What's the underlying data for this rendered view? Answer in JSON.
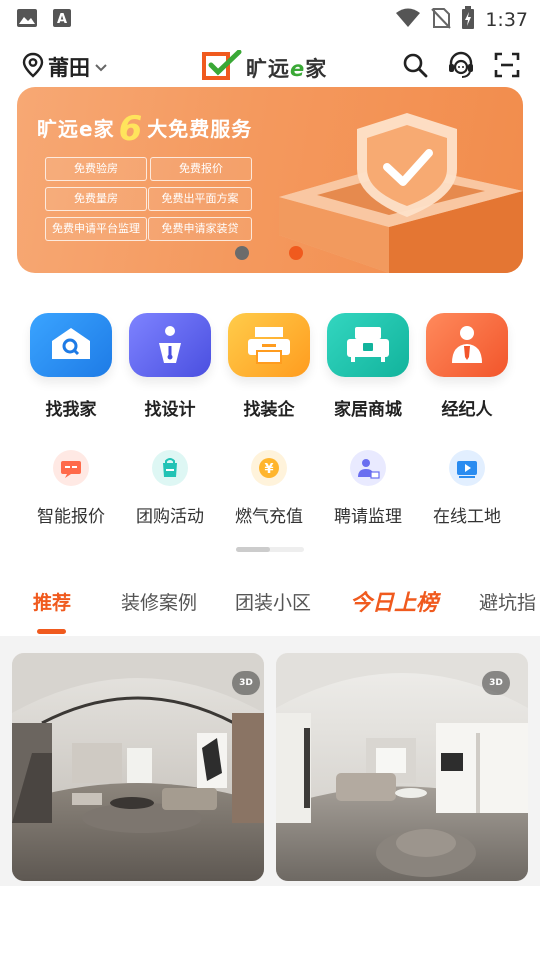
{
  "status_bar": {
    "time": "1:37",
    "icons": [
      "image-icon",
      "a-icon",
      "wifi-icon",
      "no-sim-icon",
      "battery-charging-icon"
    ]
  },
  "header": {
    "location": "莆田",
    "logo_text_a": "旷远",
    "logo_text_e": "e",
    "logo_text_b": "家",
    "icons": [
      "search-icon",
      "customer-service-icon",
      "scan-icon"
    ]
  },
  "banner": {
    "title_a": "旷远e家",
    "title_num": "6",
    "title_b": "大免费服务",
    "chips": [
      "免费验房",
      "免费报价",
      "免费量房",
      "免费出平面方案",
      "免费申请平台监理",
      "免费申请家装贷"
    ],
    "active_slide": 2,
    "slides": 2
  },
  "primary_nav": [
    {
      "label": "找我家",
      "icon": "house-search-icon",
      "color": "#2a8cf0"
    },
    {
      "label": "找设计",
      "icon": "designer-pen-icon",
      "color": "#5a5ef0"
    },
    {
      "label": "找装企",
      "icon": "printer-company-icon",
      "color": "#ffab2d"
    },
    {
      "label": "家居商城",
      "icon": "sofa-mall-icon",
      "color": "#1fc6b0"
    },
    {
      "label": "经纪人",
      "icon": "agent-person-icon",
      "color": "#ff6a40"
    }
  ],
  "secondary_nav": [
    {
      "label": "智能报价",
      "icon": "quote-chat-icon",
      "color": "#ff6a4a"
    },
    {
      "label": "团购活动",
      "icon": "group-buy-bag-icon",
      "color": "#22c3b5"
    },
    {
      "label": "燃气充值",
      "icon": "gas-yuan-coin-icon",
      "color": "#ffb52d"
    },
    {
      "label": "聘请监理",
      "icon": "supervisor-person-icon",
      "color": "#6a6ef0"
    },
    {
      "label": "在线工地",
      "icon": "live-site-video-icon",
      "color": "#2a8cf0"
    }
  ],
  "tabs": [
    {
      "label": "推荐",
      "active": true
    },
    {
      "label": "装修案例",
      "active": false
    },
    {
      "label": "团装小区",
      "active": false
    },
    {
      "label": "今日上榜",
      "active": false
    },
    {
      "label": "避坑指",
      "active": false
    }
  ],
  "feed": {
    "cards": [
      {
        "badge": "3D",
        "image": "panorama-living-room-1"
      },
      {
        "badge": "3D",
        "image": "panorama-living-room-2"
      }
    ]
  },
  "colors": {
    "accent": "#f05a1e",
    "banner": "#f4995e",
    "highlight": "#ffe45c",
    "logo_green": "#3aa836"
  }
}
